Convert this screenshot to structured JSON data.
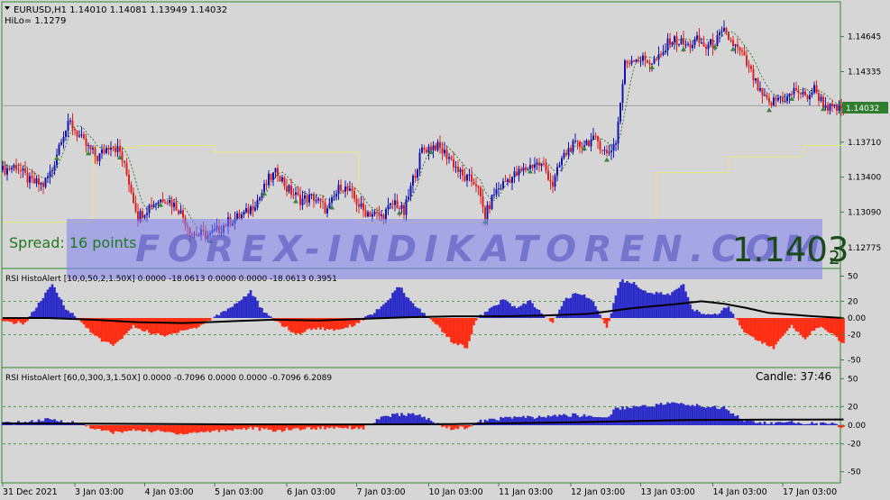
{
  "header": {
    "symbol_info": "EURUSD,H1  1.14010 1.14081 1.13949 1.14032",
    "hilo_label": "HiLo= 1.1279"
  },
  "overlay": {
    "spread_text": "Spread: 16 points",
    "watermark_text": "FOREX-INDIKATOREN.COM",
    "big_price_main": "1.1403",
    "big_price_sub": "2",
    "candle_timer": "Candle:  37:46"
  },
  "colors": {
    "background": "#d6d6d6",
    "frame": "#2f8a2f",
    "grid": "#2f8a2f",
    "candle_bull": "#1414b4",
    "candle_bear": "#e02020",
    "trail": "#2f6f2f",
    "hilo_line": "#e8e878",
    "histo_pos": "#2a2ac8",
    "histo_neg": "#ff2a10",
    "signal_line": "#000000",
    "price_tag_bg": "#2f7d2f",
    "watermark_band": "#7f7ff2",
    "watermark_text": "#3a3ab0"
  },
  "chart_data": [
    {
      "type": "candlestick",
      "title": "EURUSD,H1",
      "y_ticks": [
        "1.14645",
        "1.14335",
        "1.14032",
        "1.13710",
        "1.13400",
        "1.13090",
        "1.12775"
      ],
      "ylim": [
        1.1263,
        1.1481
      ],
      "current_price": "1.14032",
      "close_path": [
        [
          0,
          1.1346
        ],
        [
          6,
          1.135
        ],
        [
          12,
          1.1336
        ],
        [
          18,
          1.1333
        ],
        [
          22,
          1.1347
        ],
        [
          26,
          1.1376
        ],
        [
          30,
          1.1388
        ],
        [
          36,
          1.137
        ],
        [
          42,
          1.1357
        ],
        [
          48,
          1.137
        ],
        [
          52,
          1.1362
        ],
        [
          56,
          1.1336
        ],
        [
          60,
          1.1305
        ],
        [
          66,
          1.1316
        ],
        [
          72,
          1.1322
        ],
        [
          78,
          1.1312
        ],
        [
          84,
          1.129
        ],
        [
          92,
          1.1288
        ],
        [
          100,
          1.13
        ],
        [
          108,
          1.1308
        ],
        [
          114,
          1.1322
        ],
        [
          118,
          1.1338
        ],
        [
          122,
          1.1345
        ],
        [
          126,
          1.133
        ],
        [
          132,
          1.132
        ],
        [
          138,
          1.1322
        ],
        [
          144,
          1.131
        ],
        [
          150,
          1.1333
        ],
        [
          154,
          1.1326
        ],
        [
          160,
          1.131
        ],
        [
          168,
          1.1305
        ],
        [
          174,
          1.1318
        ],
        [
          178,
          1.1308
        ],
        [
          182,
          1.1338
        ],
        [
          186,
          1.1364
        ],
        [
          192,
          1.1368
        ],
        [
          198,
          1.1358
        ],
        [
          204,
          1.134
        ],
        [
          210,
          1.1335
        ],
        [
          214,
          1.1305
        ],
        [
          218,
          1.1326
        ],
        [
          224,
          1.1338
        ],
        [
          230,
          1.1345
        ],
        [
          236,
          1.1352
        ],
        [
          240,
          1.135
        ],
        [
          244,
          1.1333
        ],
        [
          248,
          1.1356
        ],
        [
          252,
          1.1367
        ],
        [
          256,
          1.1368
        ],
        [
          260,
          1.1372
        ],
        [
          264,
          1.1372
        ],
        [
          268,
          1.136
        ],
        [
          272,
          1.1372
        ],
        [
          276,
          1.144
        ],
        [
          280,
          1.1446
        ],
        [
          284,
          1.1444
        ],
        [
          288,
          1.1442
        ],
        [
          292,
          1.1446
        ],
        [
          296,
          1.1462
        ],
        [
          300,
          1.146
        ],
        [
          304,
          1.1456
        ],
        [
          308,
          1.1461
        ],
        [
          312,
          1.1455
        ],
        [
          316,
          1.146
        ],
        [
          320,
          1.1468
        ],
        [
          324,
          1.1458
        ],
        [
          328,
          1.1448
        ],
        [
          332,
          1.1432
        ],
        [
          336,
          1.1414
        ],
        [
          340,
          1.1404
        ],
        [
          344,
          1.141
        ],
        [
          348,
          1.141
        ],
        [
          352,
          1.1418
        ],
        [
          356,
          1.141
        ],
        [
          360,
          1.1418
        ],
        [
          364,
          1.1405
        ],
        [
          368,
          1.14
        ]
      ],
      "series": [
        {
          "name": "HiLo",
          "points": [
            [
              0,
              1.13
            ],
            [
              40,
              1.13
            ],
            [
              40,
              1.1366
            ],
            [
              60,
              1.1366
            ],
            [
              60,
              1.1368
            ],
            [
              94,
              1.1368
            ],
            [
              94,
              1.1362
            ],
            [
              158,
              1.1362
            ],
            [
              158,
              1.13
            ],
            [
              290,
              1.13
            ],
            [
              290,
              1.1344
            ],
            [
              322,
              1.1344
            ],
            [
              322,
              1.1358
            ],
            [
              355,
              1.1358
            ],
            [
              355,
              1.1368
            ],
            [
              373,
              1.1368
            ]
          ]
        }
      ]
    },
    {
      "type": "histogram",
      "title": "RSI HistoAlert [10,0,50,2,1.50X] 0.0000 -18.0613 0.0000 0.0000 -18.0613 0.3951",
      "y_ticks": [
        "50",
        "20",
        "0.00",
        "-20",
        "-50"
      ],
      "ylim": [
        -57,
        57
      ],
      "levels": [
        20,
        -20
      ],
      "values": [
        [
          0,
          -5
        ],
        [
          10,
          -6
        ],
        [
          22,
          40
        ],
        [
          28,
          12
        ],
        [
          32,
          2
        ],
        [
          44,
          -28
        ],
        [
          50,
          -32
        ],
        [
          58,
          -10
        ],
        [
          66,
          -18
        ],
        [
          72,
          -22
        ],
        [
          80,
          -14
        ],
        [
          86,
          -12
        ],
        [
          92,
          -2
        ],
        [
          104,
          18
        ],
        [
          110,
          32
        ],
        [
          116,
          6
        ],
        [
          124,
          -8
        ],
        [
          130,
          -20
        ],
        [
          138,
          -12
        ],
        [
          148,
          -14
        ],
        [
          156,
          -8
        ],
        [
          168,
          12
        ],
        [
          176,
          38
        ],
        [
          182,
          16
        ],
        [
          186,
          8
        ],
        [
          194,
          -12
        ],
        [
          200,
          -30
        ],
        [
          206,
          -35
        ],
        [
          210,
          -2
        ],
        [
          216,
          10
        ],
        [
          222,
          22
        ],
        [
          228,
          12
        ],
        [
          234,
          20
        ],
        [
          238,
          8
        ],
        [
          244,
          -6
        ],
        [
          250,
          24
        ],
        [
          256,
          30
        ],
        [
          262,
          20
        ],
        [
          268,
          -12
        ],
        [
          274,
          45
        ],
        [
          280,
          42
        ],
        [
          284,
          32
        ],
        [
          290,
          30
        ],
        [
          296,
          28
        ],
        [
          302,
          40
        ],
        [
          306,
          10
        ],
        [
          310,
          6
        ],
        [
          316,
          4
        ],
        [
          322,
          14
        ],
        [
          330,
          -20
        ],
        [
          336,
          -28
        ],
        [
          342,
          -36
        ],
        [
          346,
          -22
        ],
        [
          350,
          -10
        ],
        [
          356,
          -24
        ],
        [
          362,
          -10
        ],
        [
          368,
          -20
        ],
        [
          373,
          -30
        ]
      ],
      "signal": [
        [
          0,
          0
        ],
        [
          20,
          0
        ],
        [
          40,
          -2
        ],
        [
          60,
          -5
        ],
        [
          80,
          -6
        ],
        [
          100,
          -4
        ],
        [
          120,
          -2
        ],
        [
          140,
          -3
        ],
        [
          160,
          -1
        ],
        [
          180,
          1
        ],
        [
          200,
          2
        ],
        [
          220,
          2
        ],
        [
          240,
          3
        ],
        [
          260,
          5
        ],
        [
          280,
          12
        ],
        [
          300,
          17
        ],
        [
          310,
          20
        ],
        [
          320,
          17
        ],
        [
          330,
          12
        ],
        [
          340,
          6
        ],
        [
          350,
          4
        ],
        [
          360,
          2
        ],
        [
          373,
          0
        ]
      ]
    },
    {
      "type": "histogram",
      "title": "RSI HistoAlert [60,0,300,3,1.50X] 0.0000 -0.7096 0.0000 0.0000 -0.7096 6.2089",
      "y_ticks": [
        "50",
        "20",
        "0.00",
        "-20",
        "-50"
      ],
      "ylim": [
        -60,
        60
      ],
      "levels": [
        20,
        -20
      ],
      "values": [
        [
          0,
          2
        ],
        [
          10,
          3
        ],
        [
          20,
          6
        ],
        [
          28,
          4
        ],
        [
          36,
          1
        ],
        [
          42,
          -5
        ],
        [
          50,
          -8
        ],
        [
          60,
          -5
        ],
        [
          70,
          -7
        ],
        [
          80,
          -9
        ],
        [
          90,
          -7
        ],
        [
          100,
          -5
        ],
        [
          110,
          -3
        ],
        [
          120,
          -6
        ],
        [
          130,
          -4
        ],
        [
          140,
          -3
        ],
        [
          150,
          -2
        ],
        [
          160,
          -3
        ],
        [
          170,
          10
        ],
        [
          180,
          12
        ],
        [
          186,
          10
        ],
        [
          192,
          2
        ],
        [
          200,
          -4
        ],
        [
          206,
          -2
        ],
        [
          212,
          4
        ],
        [
          220,
          7
        ],
        [
          228,
          9
        ],
        [
          236,
          8
        ],
        [
          244,
          10
        ],
        [
          252,
          11
        ],
        [
          260,
          10
        ],
        [
          268,
          8
        ],
        [
          272,
          18
        ],
        [
          280,
          20
        ],
        [
          288,
          21
        ],
        [
          296,
          24
        ],
        [
          304,
          22
        ],
        [
          312,
          20
        ],
        [
          320,
          19
        ],
        [
          326,
          10
        ],
        [
          330,
          4
        ],
        [
          340,
          2
        ],
        [
          350,
          3
        ],
        [
          360,
          2
        ],
        [
          368,
          1
        ],
        [
          373,
          -2
        ]
      ],
      "signal": [
        [
          0,
          2
        ],
        [
          60,
          1.5
        ],
        [
          100,
          1
        ],
        [
          150,
          0.8
        ],
        [
          200,
          1.2
        ],
        [
          250,
          3
        ],
        [
          300,
          5.5
        ],
        [
          340,
          6
        ],
        [
          373,
          6.2
        ]
      ]
    }
  ],
  "time_axis": {
    "labels": [
      "31 Dec 2021",
      "3 Jan 03:00",
      "4 Jan 03:00",
      "5 Jan 03:00",
      "6 Jan 03:00",
      "7 Jan 03:00",
      "10 Jan 03:00",
      "11 Jan 03:00",
      "12 Jan 03:00",
      "13 Jan 03:00",
      "14 Jan 03:00",
      "17 Jan 03:00"
    ]
  }
}
